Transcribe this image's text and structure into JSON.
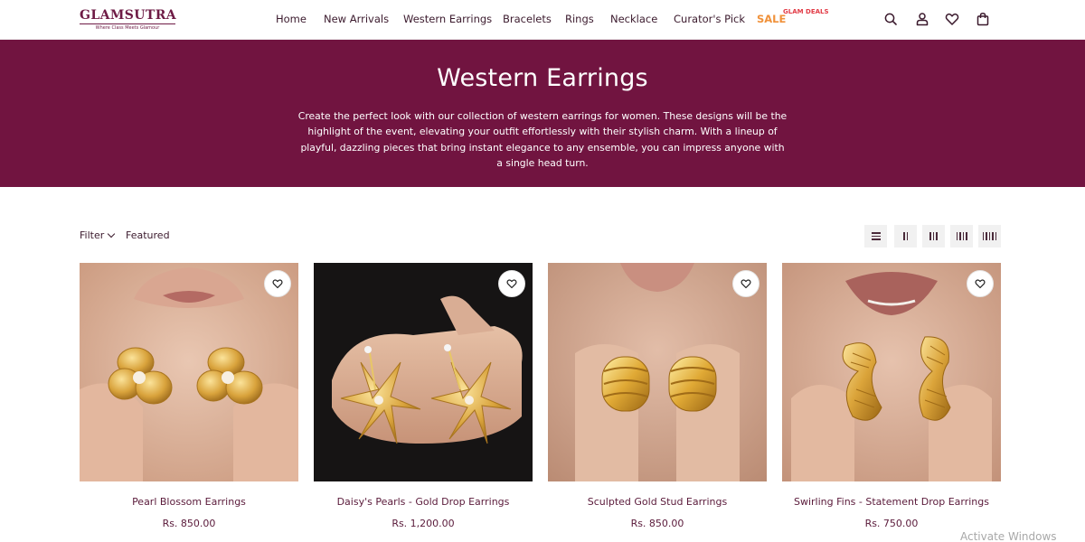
{
  "brand": {
    "name": "GLAMSUTRA",
    "tagline": "Where Class Meets Glamour",
    "color": "#6e1b45",
    "hero_color": "#711440"
  },
  "nav": {
    "items": [
      "Home",
      "New Arrivals",
      "Western Earrings",
      "Bracelets",
      "Rings",
      "Necklace",
      "Curator's Pick"
    ],
    "sale_label": "SALE",
    "sale_badge": "GLAM DEALS"
  },
  "header_icons": [
    "search-icon",
    "account-icon",
    "heart-icon",
    "bag-icon"
  ],
  "hero": {
    "title": "Western Earrings",
    "description": "Create the perfect look with our collection of western earrings for women. These designs will be the highlight of the event, elevating your outfit effortlessly with their stylish charm. With a lineup of playful, dazzling pieces that bring instant elegance to any ensemble, you can impress anyone with a single head turn."
  },
  "toolbar": {
    "filter_label": "Filter",
    "sort_label": "Featured",
    "view_options": [
      "list",
      "2-columns",
      "3-columns",
      "4-columns",
      "5-columns"
    ]
  },
  "products": [
    {
      "name": "Pearl Blossom Earrings",
      "price": "Rs. 850.00"
    },
    {
      "name": "Daisy's Pearls - Gold Drop Earrings",
      "price": "Rs. 1,200.00"
    },
    {
      "name": "Sculpted Gold Stud Earrings",
      "price": "Rs. 850.00"
    },
    {
      "name": "Swirling Fins - Statement Drop Earrings",
      "price": "Rs. 750.00"
    }
  ],
  "os_watermark": "Activate Windows"
}
